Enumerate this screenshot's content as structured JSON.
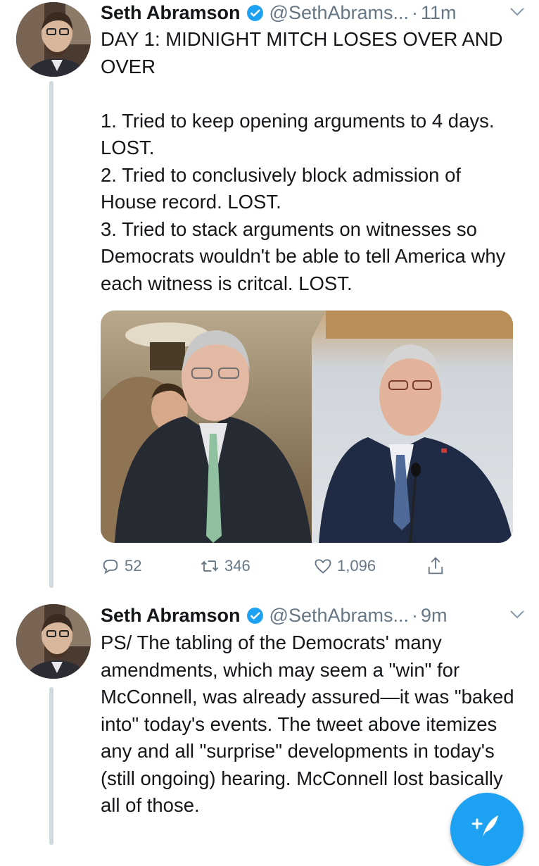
{
  "tweets": [
    {
      "author_name": "Seth Abramson",
      "handle": "@SethAbrams...",
      "separator": "·",
      "time": "11m",
      "text": "DAY 1: MIDNIGHT MITCH LOSES OVER AND OVER\n\n1. Tried to keep opening arguments to 4 days. LOST.\n2. Tried to conclusively block admission of House record. LOST.\n3. Tried to stack arguments on witnesses so Democrats wouldn't be able to tell America why each witness is critcal. LOST.",
      "stats": {
        "replies": "52",
        "retweets": "346",
        "likes": "1,096"
      }
    },
    {
      "author_name": "Seth Abramson",
      "handle": "@SethAbrams...",
      "separator": "·",
      "time": "9m",
      "text": "PS/ The tabling of the Democrats' many amendments, which may seem a \"win\" for McConnell, was already assured—it was \"baked into\" today's events. The tweet above itemizes any and all \"surprise\" developments in today's (still ongoing) hearing. McConnell lost basically all of those."
    }
  ],
  "colors": {
    "accent": "#1da1f2",
    "secondary_text": "#657786",
    "thread_line": "#cfd9de"
  },
  "icons": {
    "verified": "verified-badge-icon",
    "reply": "reply-icon",
    "retweet": "retweet-icon",
    "like": "heart-icon",
    "share": "share-icon",
    "compose": "compose-tweet-icon"
  }
}
